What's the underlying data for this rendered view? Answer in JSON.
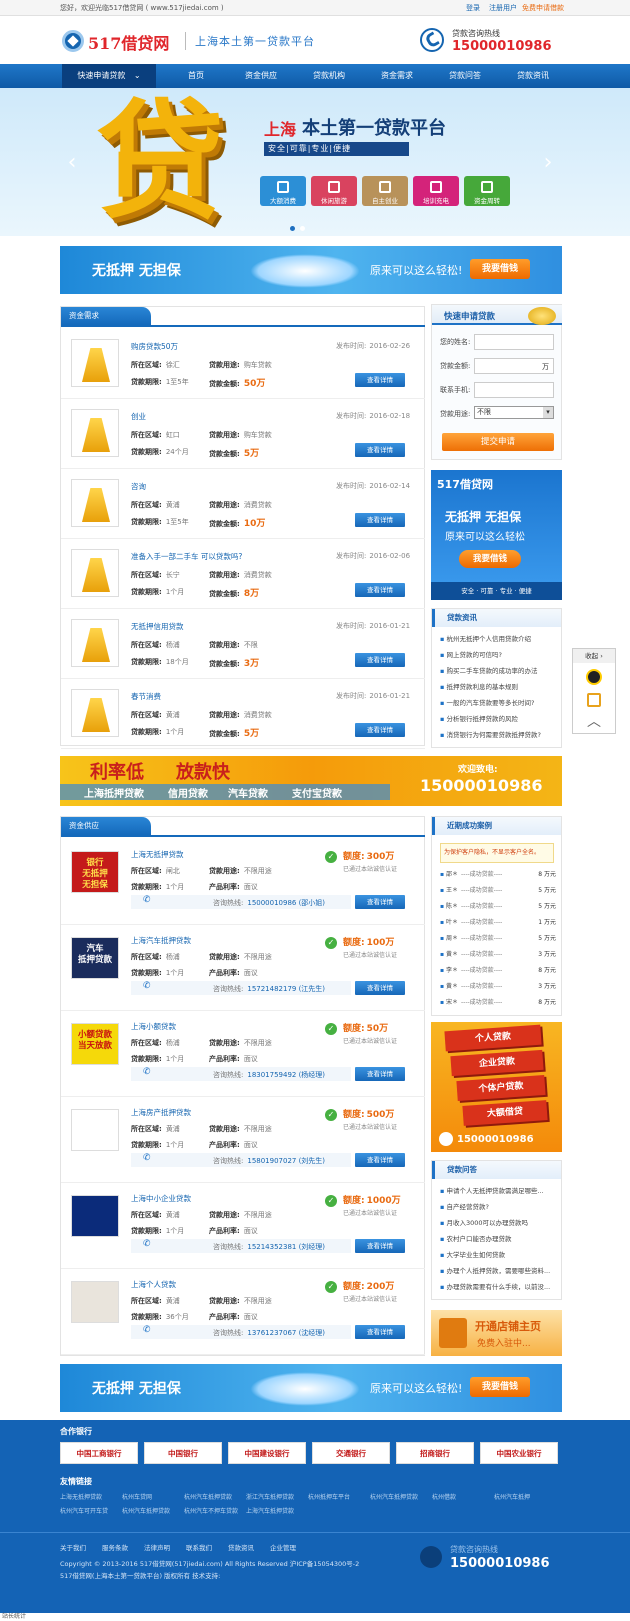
{
  "topbar": {
    "welcome": "您好，欢迎光临517借贷网 ( www.517jiedai.com )",
    "login": "登录",
    "register": "注册用户",
    "apply": "免费申请借款"
  },
  "header": {
    "logo_text": "517借贷网",
    "slogan": "上海本土第一贷款平台",
    "hotline_label": "贷款咨询热线",
    "hotline": "15000010986"
  },
  "nav": {
    "quick": "快速申请贷款",
    "items": [
      "首页",
      "资金供应",
      "贷款机构",
      "资金需求",
      "贷款问答",
      "贷款资讯"
    ]
  },
  "hero": {
    "big_char": "贷",
    "title_a": "上海",
    "title_b": "本土第一贷款平台",
    "subtitle": "安全|可靠|专业|便捷",
    "tiles": [
      {
        "label": "大额消费",
        "color": "#2c8fd6"
      },
      {
        "label": "休闲旅游",
        "color": "#d9435f"
      },
      {
        "label": "自主创业",
        "color": "#b8925a"
      },
      {
        "label": "培训充电",
        "color": "#d4237a"
      },
      {
        "label": "资金周转",
        "color": "#46a83a"
      }
    ]
  },
  "banner": {
    "left": "无抵押  无担保",
    "middle": "原来可以这么轻松!",
    "button": "我要借钱"
  },
  "demand": {
    "title": "资金需求",
    "labels": {
      "area": "所在区域:",
      "use": "贷款用途:",
      "term": "贷款期限:",
      "amount": "贷款金额:",
      "time": "发布时间:"
    },
    "button": "查看详情",
    "items": [
      {
        "title": "购房贷款50万",
        "area": "徐汇",
        "use": "购车贷款",
        "term": "1至5年",
        "amount": "50万",
        "time": "2016-02-26"
      },
      {
        "title": "创业",
        "area": "虹口",
        "use": "购车贷款",
        "term": "24个月",
        "amount": "5万",
        "time": "2016-02-18"
      },
      {
        "title": "咨询",
        "area": "黄浦",
        "use": "消费贷款",
        "term": "1至5年",
        "amount": "10万",
        "time": "2016-02-14"
      },
      {
        "title": "准备入手一部二手车  可以贷款吗?",
        "area": "长宁",
        "use": "消费贷款",
        "term": "1个月",
        "amount": "8万",
        "time": "2016-02-06"
      },
      {
        "title": "无抵押信用贷款",
        "area": "杨浦",
        "use": "不限",
        "term": "18个月",
        "amount": "3万",
        "time": "2016-01-21"
      },
      {
        "title": "春节消费",
        "area": "黄浦",
        "use": "消费贷款",
        "term": "1个月",
        "amount": "5万",
        "time": "2016-01-21"
      }
    ]
  },
  "quick_form": {
    "title": "快速申请贷款",
    "name_label": "您的姓名:",
    "amount_label": "贷款金额:",
    "amount_unit": "万",
    "phone_label": "联系手机:",
    "use_label": "贷款用途:",
    "use_value": "不限",
    "submit": "提交申请"
  },
  "side_ad1": {
    "logo": "517借贷网",
    "line1": "无抵押  无担保",
    "line2": "原来可以这么轻松",
    "button": "我要借钱",
    "footer": "安全 · 可靠 · 专业 · 便捷"
  },
  "news": {
    "title": "贷款资讯",
    "items": [
      "杭州无抵押个人信用贷款介绍",
      "网上贷款的可信吗?",
      "购买二手车贷款的成功率的办法",
      "抵押贷款利息的基本规则",
      "一般的汽车贷款要等多长时间?",
      "分析银行抵押贷款的风险",
      "消贷银行为何需要贷款抵押贷款?"
    ]
  },
  "float_tool": {
    "title": "收起"
  },
  "mid_banner": {
    "big1": "利率低",
    "big2": "放款快",
    "subs": [
      "上海抵押贷款",
      "信用贷款",
      "汽车贷款",
      "支付宝贷款"
    ],
    "call_label": "欢迎致电:",
    "phone": "15000010986"
  },
  "supply": {
    "title": "资金供应",
    "labels": {
      "area": "所在区域:",
      "use": "贷款用途:",
      "term": "贷款期限:",
      "product": "产品利率:",
      "consult": "咨询热线:",
      "quota": "额度:",
      "cert": "已通过本站诚信认证"
    },
    "button": "查看详情",
    "items": [
      {
        "title": "上海无抵押贷款",
        "area": "闸北",
        "use": "不限用途",
        "term": "1个月",
        "rate": "面议",
        "phone": "15000010986 (邵小姐)",
        "quota": "300万",
        "thumb": "银行\n无抵押\n无担保",
        "thumb_bg": "#c41a1a",
        "thumb_fg": "#ffe14a"
      },
      {
        "title": "上海汽车抵押贷款",
        "area": "杨浦",
        "use": "不限用途",
        "term": "1个月",
        "rate": "面议",
        "phone": "15721482179 (江先生)",
        "quota": "100万",
        "thumb": "汽车\n抵押贷款",
        "thumb_bg": "#1a2c5c",
        "thumb_fg": "#ffffff"
      },
      {
        "title": "上海小额贷款",
        "area": "杨浦",
        "use": "不限用途",
        "term": "1个月",
        "rate": "面议",
        "phone": "18301759492 (杨经理)",
        "quota": "50万",
        "thumb": "小额贷款\n当天放款",
        "thumb_bg": "#f5d90a",
        "thumb_fg": "#c81010"
      },
      {
        "title": "上海房产抵押贷款",
        "area": "黄浦",
        "use": "不限用途",
        "term": "1个月",
        "rate": "面议",
        "phone": "15801907027 (刘先生)",
        "quota": "500万",
        "thumb": "",
        "thumb_bg": "#ffffff",
        "thumb_fg": "#333333"
      },
      {
        "title": "上海中小企业贷款",
        "area": "黄浦",
        "use": "不限用途",
        "term": "1个月",
        "rate": "面议",
        "phone": "15214352381 (刘经理)",
        "quota": "1000万",
        "thumb": "",
        "thumb_bg": "#0b2b7a",
        "thumb_fg": "#ffffff"
      },
      {
        "title": "上海个人贷款",
        "area": "黄浦",
        "use": "不限用途",
        "term": "36个月",
        "rate": "面议",
        "phone": "13761237067 (沈经理)",
        "quota": "200万",
        "thumb": "",
        "thumb_bg": "#e9e4dc",
        "thumb_fg": "#333333"
      }
    ]
  },
  "cases": {
    "title": "近期成功案例",
    "notice": "为保护客户隐私，不显示客户全名。",
    "items": [
      {
        "name": "邵＊",
        "mid": "----成功贷款----",
        "amt": "8 万元"
      },
      {
        "name": "王＊",
        "mid": "----成功贷款----",
        "amt": "5 万元"
      },
      {
        "name": "陈＊",
        "mid": "----成功贷款----",
        "amt": "5 万元"
      },
      {
        "name": "叶＊",
        "mid": "----成功贷款----",
        "amt": "1 万元"
      },
      {
        "name": "周＊",
        "mid": "----成功贷款----",
        "amt": "5 万元"
      },
      {
        "name": "黄＊",
        "mid": "----成功贷款----",
        "amt": "3 万元"
      },
      {
        "name": "李＊",
        "mid": "----成功贷款----",
        "amt": "8 万元"
      },
      {
        "name": "黄＊",
        "mid": "----成功贷款----",
        "amt": "3 万元"
      },
      {
        "name": "宋＊",
        "mid": "----成功贷款----",
        "amt": "8 万元"
      }
    ]
  },
  "side_ad2": {
    "ribbons": [
      "个人贷款",
      "企业贷款",
      "个体户贷款",
      "大额借贷"
    ],
    "phone": "15000010986"
  },
  "qa": {
    "title": "贷款问答",
    "items": [
      "申请个人无抵押贷款需满足哪些...",
      "自产经营贷款?",
      "月收入3000可以办理贷款吗",
      "农村户口能否办理贷款",
      "大学毕业生如何贷款",
      "办理个人抵押贷款，需要哪些资料...",
      "办理贷款需要有什么手续，以前没..."
    ]
  },
  "side_ad3": {
    "line1": "开通店铺主页",
    "line2": "免费入驻中..."
  },
  "footer": {
    "partners_title": "合作银行",
    "banks": [
      "中国工商银行",
      "中国银行",
      "中国建设银行",
      "交通银行",
      "招商银行",
      "中国农业银行"
    ],
    "links_title": "友情链接",
    "links_row1": [
      "上海无抵押贷款",
      "杭州车贷网",
      "杭州汽车抵押贷款",
      "浙江汽车抵押贷款",
      "杭州抵押车平台",
      "杭州汽车抵押贷款",
      "杭州借款",
      "杭州汽车抵押"
    ],
    "links_row2": [
      "杭州汽车可开车贷",
      "杭州汽车抵押贷款",
      "杭州汽车不押车贷款",
      "上海汽车抵押贷款"
    ],
    "menu": [
      "关于我们",
      "服务条款",
      "法律声明",
      "联系我们",
      "贷款资讯",
      "企业管理"
    ],
    "copyright": "Copyright © 2013-2016 517借贷网(517jiedai.com) All Rights Reserved  沪ICP备15054300号-2",
    "copyright2": "517借贷网(上海本土第一贷款平台)  版权所有  技术支持:",
    "hotline_label": "贷款咨询热线",
    "hotline": "15000010986"
  },
  "status": "站长统计"
}
